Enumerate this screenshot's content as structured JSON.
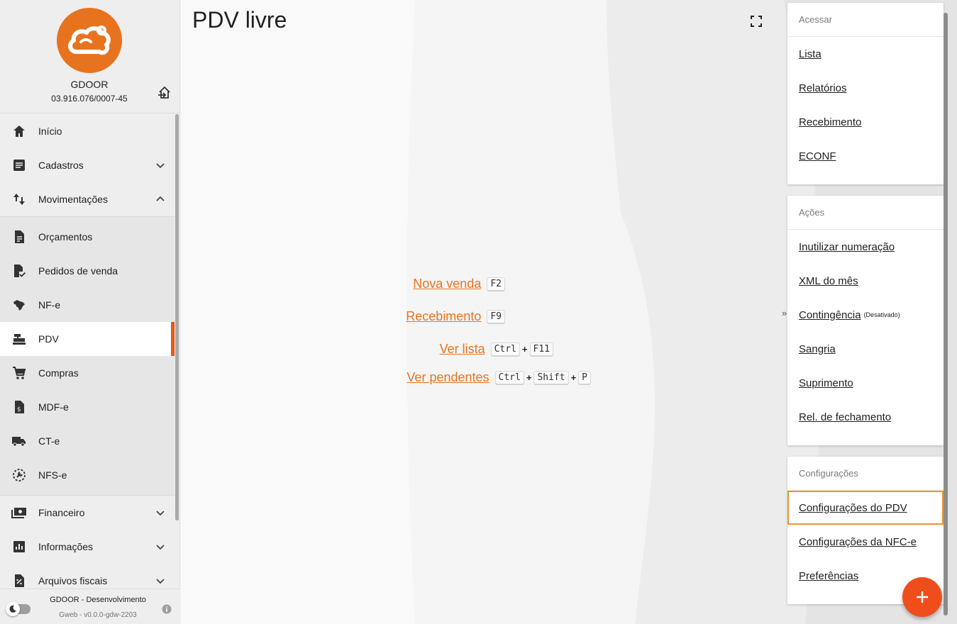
{
  "company": {
    "name": "GDOOR",
    "cnpj": "03.916.076/0007-45"
  },
  "nav": {
    "top_items": [
      {
        "label": "Início",
        "icon": "home-icon"
      },
      {
        "label": "Cadastros",
        "icon": "list-box-icon"
      },
      {
        "label": "Movimentações",
        "icon": "swap-vertical-icon"
      }
    ],
    "movimentacoes_items": [
      {
        "label": "Orçamentos",
        "icon": "document-icon"
      },
      {
        "label": "Pedidos de venda",
        "icon": "document-check-icon"
      },
      {
        "label": "NF-e",
        "icon": "brazil-map-icon"
      },
      {
        "label": "PDV",
        "icon": "cash-register-icon"
      },
      {
        "label": "Compras",
        "icon": "cart-icon"
      },
      {
        "label": "MDF-e",
        "icon": "document-dollar-icon"
      },
      {
        "label": "CT-e",
        "icon": "truck-icon"
      },
      {
        "label": "NFS-e",
        "icon": "service-wrench-icon"
      }
    ],
    "bottom_items": [
      {
        "label": "Financeiro",
        "icon": "cash-icon"
      },
      {
        "label": "Informações",
        "icon": "bar-chart-icon"
      },
      {
        "label": "Arquivos fiscais",
        "icon": "fiscal-file-icon"
      }
    ]
  },
  "footer": {
    "environment": "GDOOR - Desenvolvimento",
    "version": "Gweb - v0.0.0-gdw-2203"
  },
  "main": {
    "title": "PDV livre",
    "shortcuts": [
      {
        "label": "Nova venda",
        "keys": [
          "F2"
        ]
      },
      {
        "label": "Recebimento",
        "keys": [
          "F9"
        ]
      },
      {
        "label": "Ver lista",
        "keys": [
          "Ctrl",
          "F11"
        ]
      },
      {
        "label": "Ver pendentes",
        "keys": [
          "Ctrl",
          "Shift",
          "P"
        ]
      }
    ]
  },
  "right_panel": {
    "acessar": {
      "header": "Acessar",
      "items": [
        "Lista",
        "Relatórios",
        "Recebimento",
        "ECONF"
      ]
    },
    "acoes": {
      "header": "Ações",
      "items": [
        "Inutilizar numeração",
        "XML do mês",
        "Contingência",
        "Sangria",
        "Suprimento",
        "Rel. de fechamento"
      ],
      "contingencia_note": "(Desativado)"
    },
    "configuracoes": {
      "header": "Configurações",
      "items": [
        "Configurações do PDV",
        "Configurações da NFC-e",
        "Preferências"
      ]
    }
  },
  "colors": {
    "accent": "#e8731f",
    "active_bar": "#e8581c",
    "fab": "#ef4e1c",
    "highlight_outline": "#f0932b"
  }
}
